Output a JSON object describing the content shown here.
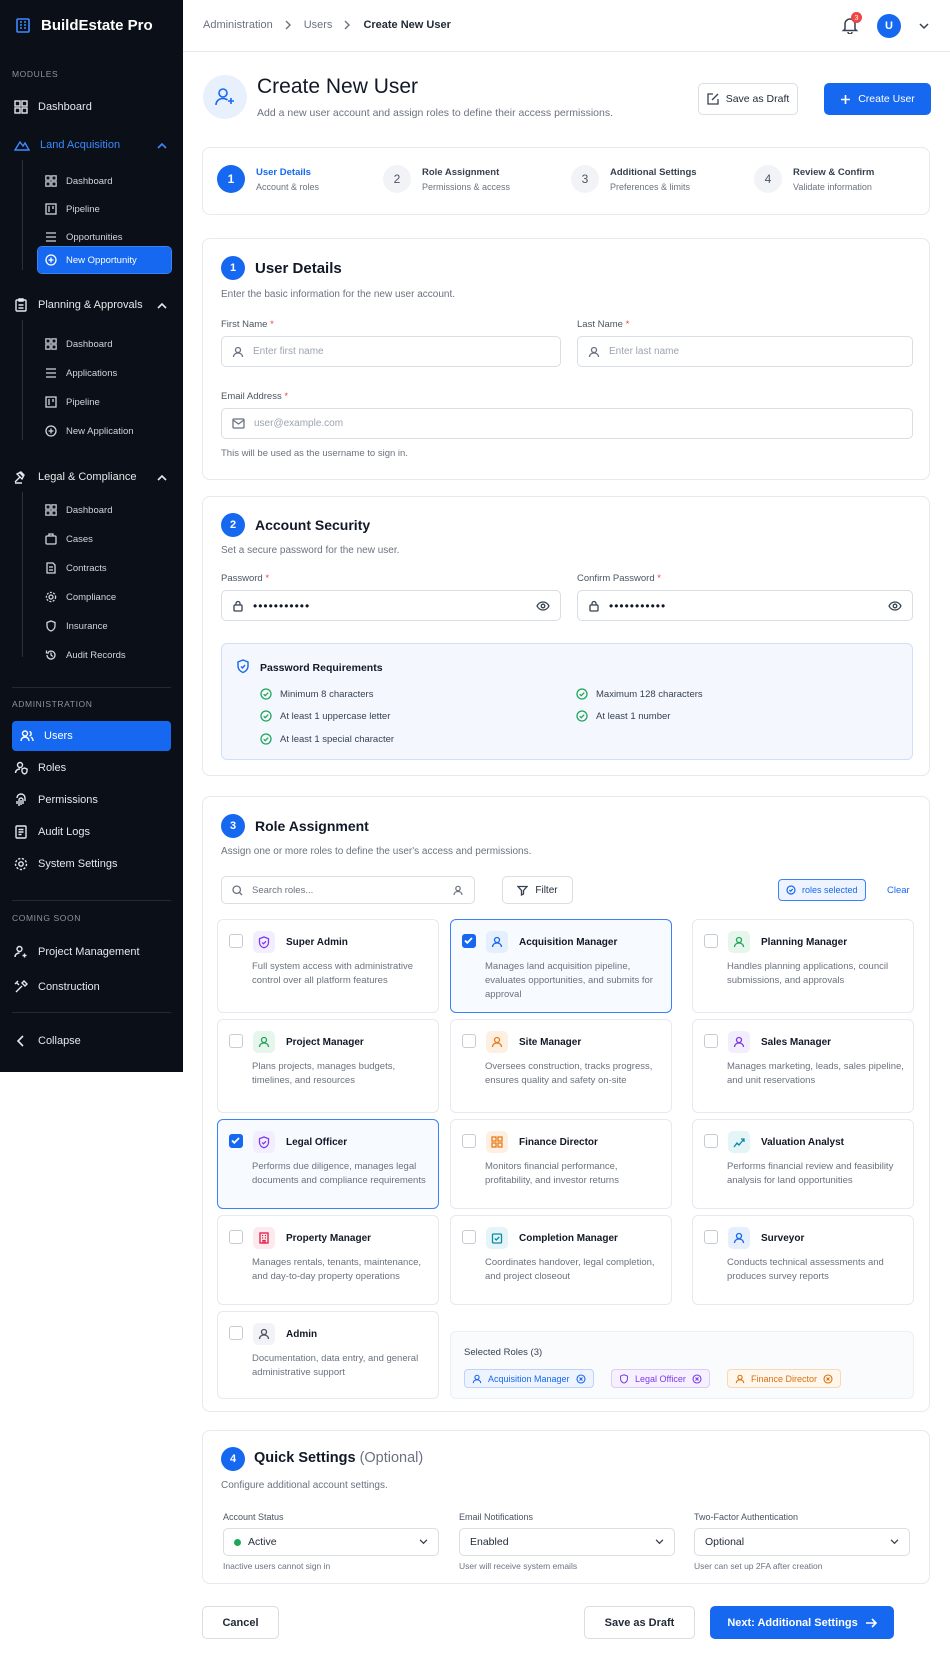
{
  "app": {
    "name": "BuildEstate Pro"
  },
  "sidebar": {
    "modules_label": "MODULES",
    "dashboard": "Dashboard",
    "land": {
      "label": "Land Acquisition",
      "items": [
        "Dashboard",
        "Pipeline",
        "Opportunities",
        "New Opportunity"
      ]
    },
    "planning": {
      "label": "Planning & Approvals",
      "items": [
        "Dashboard",
        "Applications",
        "Pipeline",
        "New Application"
      ]
    },
    "legal": {
      "label": "Legal & Compliance",
      "items": [
        "Dashboard",
        "Cases",
        "Contracts",
        "Compliance",
        "Insurance",
        "Audit Records"
      ]
    },
    "admin_label": "ADMINISTRATION",
    "admin_items": [
      "Users",
      "Roles",
      "Permissions",
      "Audit Logs",
      "System Settings"
    ],
    "soon_label": "COMING SOON",
    "soon_items": [
      "Project Management",
      "Construction"
    ],
    "collapse": "Collapse"
  },
  "topbar": {
    "breadcrumb": [
      "Administration",
      "Users",
      "Create New User"
    ],
    "notif_count": "3",
    "avatar": "U"
  },
  "header": {
    "title": "Create New User",
    "subtitle": "Add a new user account and assign roles to define their access permissions.",
    "save_draft": "Save as Draft",
    "create": "Create User"
  },
  "stepper": [
    {
      "n": "1",
      "title": "User Details",
      "sub": "Account & roles"
    },
    {
      "n": "2",
      "title": "Role Assignment",
      "sub": "Permissions & access"
    },
    {
      "n": "3",
      "title": "Additional Settings",
      "sub": "Preferences & limits"
    },
    {
      "n": "4",
      "title": "Review & Confirm",
      "sub": "Validate information"
    }
  ],
  "user_details": {
    "n": "1",
    "title": "User Details",
    "desc": "Enter the basic information for the new user account.",
    "first_label": "First Name",
    "first_ph": "Enter first name",
    "last_label": "Last Name",
    "last_ph": "Enter last name",
    "email_label": "Email Address",
    "email_ph": "user@example.com",
    "email_help": "This will be used as the username to sign in.",
    "required": "*"
  },
  "security": {
    "n": "2",
    "title": "Account Security",
    "desc": "Set a secure password for the new user.",
    "pw_label": "Password",
    "pw_value": "•••••••••••",
    "confirm_label": "Confirm Password",
    "confirm_value": "•••••••••••",
    "req_title": "Password Requirements",
    "reqs": [
      "Minimum 8 characters",
      "Maximum 128 characters",
      "At least 1 uppercase letter",
      "At least 1 number",
      "At least 1 special character"
    ]
  },
  "roles": {
    "n": "3",
    "title": "Role Assignment",
    "desc": "Assign one or more roles to define the user's access and permissions.",
    "search_ph": "Search roles...",
    "filter": "Filter",
    "selected_badge": "roles selected",
    "clear": "Clear",
    "items": [
      {
        "name": "Super Admin",
        "desc": "Full system access with administrative control over all platform features",
        "checked": false
      },
      {
        "name": "Acquisition Manager",
        "desc": "Manages land acquisition pipeline, evaluates opportunities, and submits for approval",
        "checked": true
      },
      {
        "name": "Planning Manager",
        "desc": "Handles planning applications, council submissions, and approvals",
        "checked": false
      },
      {
        "name": "Project Manager",
        "desc": "Plans projects, manages budgets, timelines, and resources",
        "checked": false
      },
      {
        "name": "Site Manager",
        "desc": "Oversees construction, tracks progress, ensures quality and safety on-site",
        "checked": false
      },
      {
        "name": "Sales Manager",
        "desc": "Manages marketing, leads, sales pipeline, and unit reservations",
        "checked": false
      },
      {
        "name": "Legal Officer",
        "desc": "Performs due diligence, manages legal documents and compliance requirements",
        "checked": true
      },
      {
        "name": "Finance Director",
        "desc": "Monitors financial performance, profitability, and investor returns",
        "checked": false
      },
      {
        "name": "Valuation Analyst",
        "desc": "Performs financial review and feasibility analysis for land opportunities",
        "checked": false
      },
      {
        "name": "Property Manager",
        "desc": "Manages rentals, tenants, maintenance, and day-to-day property operations",
        "checked": false
      },
      {
        "name": "Completion Manager",
        "desc": "Coordinates handover, legal completion, and project closeout",
        "checked": false
      },
      {
        "name": "Surveyor",
        "desc": "Conducts technical assessments and produces survey reports",
        "checked": false
      },
      {
        "name": "Admin",
        "desc": "Documentation, data entry, and general administrative support",
        "checked": false
      }
    ],
    "selected_title": "Selected Roles (3)",
    "selected": [
      "Acquisition Manager",
      "Legal Officer",
      "Finance Director"
    ]
  },
  "quick": {
    "n": "4",
    "title": "Quick Settings",
    "optional": "(Optional)",
    "desc": "Configure additional account settings.",
    "status_label": "Account Status",
    "status_value": "Active",
    "status_help": "Inactive users cannot sign in",
    "email_label": "Email Notifications",
    "email_value": "Enabled",
    "email_help": "User will receive system emails",
    "tfa_label": "Two-Factor Authentication",
    "tfa_value": "Optional",
    "tfa_help": "User can set up 2FA after creation"
  },
  "footer": {
    "cancel": "Cancel",
    "save_draft": "Save as Draft",
    "next": "Next: Additional Settings"
  },
  "colors": {
    "primary": "#1668f0",
    "sidebar": "#0b0f17",
    "success": "#22a55b",
    "danger": "#ef4444"
  }
}
